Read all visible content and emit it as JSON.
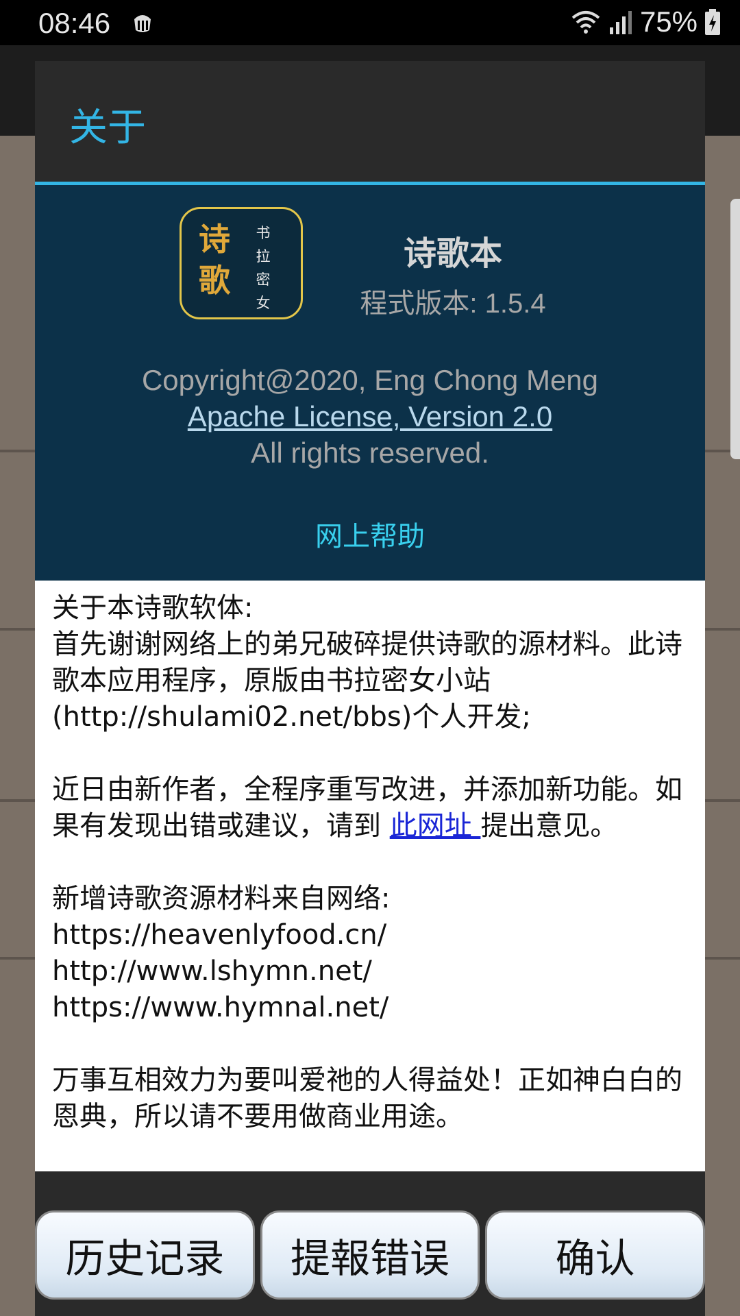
{
  "status_bar": {
    "time": "08:46",
    "battery": "75%",
    "icons": [
      "notification-app-icon",
      "wifi-icon",
      "signal-icon",
      "battery-charging-icon"
    ]
  },
  "dialog": {
    "title": "关于",
    "app_name": "诗歌本",
    "version": "程式版本: 1.5.4",
    "logo": {
      "big_chars": [
        "诗",
        "歌"
      ],
      "small_chars": [
        "书",
        "拉",
        "密",
        "女"
      ]
    },
    "copyright": "Copyright@2020, Eng Chong Meng",
    "license": "Apache License, Version 2.0",
    "rights": "All rights reserved.",
    "help_link": "网上帮助",
    "content": {
      "p1_line1": "关于本诗歌软体:",
      "p1_line2": "首先谢谢网络上的弟兄破碎提供诗歌的源材料。此诗歌本应用程序，原版由书拉密女小站(http://shulami02.net/bbs)个人开发;",
      "p2_before": "近日由新作者，全程序重写改进，并添加新功能。如果有发现出错或建议，请到 ",
      "p2_link": "此网址 ",
      "p2_after": "提出意见。",
      "p3_heading": "新增诗歌资源材料来自网络:",
      "p3_urls": [
        "https://heavenlyfood.cn/",
        "http://www.lshymn.net/",
        "https://www.hymnal.net/"
      ],
      "p4": "万事互相效力为要叫爱祂的人得益处！正如神白白的恩典，所以请不要用做商业用途。"
    },
    "buttons": {
      "history": "历史记录",
      "report": "提報错误",
      "confirm": "确认"
    }
  },
  "colors": {
    "accent": "#33b5e5",
    "panel_bg": "#0c3149",
    "help_link": "#39d0ee",
    "logo_border": "#e3c64a"
  }
}
